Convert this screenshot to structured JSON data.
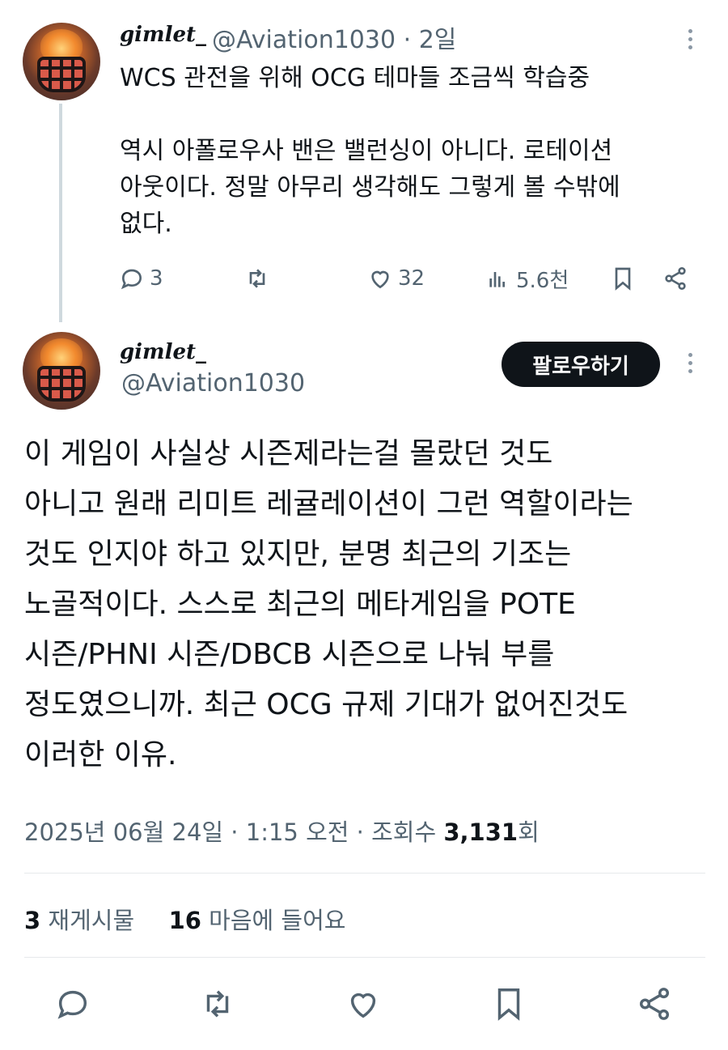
{
  "reply_tweet": {
    "display_name": "gimlet_",
    "handle": "@Aviation1030",
    "separator": "·",
    "time_ago": "2일",
    "text_lines": [
      "WCS 관전을 위해 OCG 테마들 조금씩 학습중",
      "",
      "역시 아폴로우사 밴은 밸런싱이 아니다. 로테이션",
      "아웃이다. 정말 아무리 생각해도 그렇게 볼 수밖에",
      "없다."
    ],
    "actions": {
      "reply_count": "3",
      "retweet_count": "",
      "like_count": "32",
      "views_count": "5.6천"
    }
  },
  "main_tweet": {
    "display_name": "gimlet_",
    "handle": "@Aviation1030",
    "follow_label": "팔로우하기",
    "text_lines": [
      "이 게임이 사실상 시즌제라는걸 몰랐던 것도",
      "아니고 원래 리미트 레귤레이션이 그런 역할이라는",
      "것도 인지야 하고 있지만,  분명 최근의 기조는",
      "노골적이다. 스스로 최근의 메타게임을 POTE",
      "시즌/PHNI 시즌/DBCB 시즌으로 나눠 부를",
      "정도였으니까. 최근 OCG 규제 기대가 없어진것도",
      "이러한 이유."
    ],
    "timestamp": "2025년 06월 24일 · 1:15 오전 · 조회수 ",
    "views_number": "3,131",
    "views_suffix": "회",
    "retweets_number": "3",
    "retweets_label": " 재게시물",
    "likes_number": "16",
    "likes_label": " 마음에 들어요"
  },
  "icons": {
    "reply": "reply-icon",
    "retweet": "retweet-icon",
    "like": "heart-icon",
    "views": "views-icon",
    "bookmark": "bookmark-icon",
    "share": "share-icon",
    "more": "more-icon"
  },
  "colors": {
    "text": "#0f1419",
    "muted": "#536471",
    "follow_bg": "#0f1419",
    "follow_text": "#ffffff",
    "divider": "#e6e9eb"
  }
}
